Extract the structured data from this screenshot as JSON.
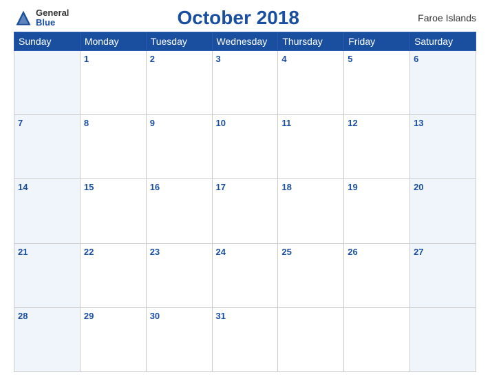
{
  "header": {
    "logo_general": "General",
    "logo_blue": "Blue",
    "month_title": "October 2018",
    "region": "Faroe Islands"
  },
  "weekdays": [
    "Sunday",
    "Monday",
    "Tuesday",
    "Wednesday",
    "Thursday",
    "Friday",
    "Saturday"
  ],
  "weeks": [
    [
      null,
      1,
      2,
      3,
      4,
      5,
      6
    ],
    [
      7,
      8,
      9,
      10,
      11,
      12,
      13
    ],
    [
      14,
      15,
      16,
      17,
      18,
      19,
      20
    ],
    [
      21,
      22,
      23,
      24,
      25,
      26,
      27
    ],
    [
      28,
      29,
      30,
      31,
      null,
      null,
      null
    ]
  ]
}
